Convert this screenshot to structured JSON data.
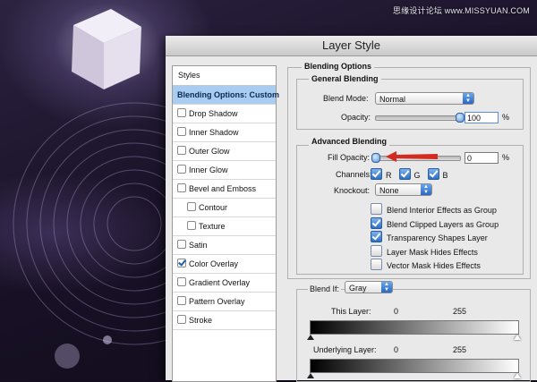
{
  "watermark": "思缘设计论坛 www.MISSYUAN.COM",
  "dialog": {
    "title": "Layer Style",
    "styles_header": "Styles",
    "styles": [
      {
        "label": "Blending Options: Custom",
        "selected": true,
        "checkbox": false,
        "checked": false,
        "indent": false
      },
      {
        "label": "Drop Shadow",
        "selected": false,
        "checkbox": true,
        "checked": false,
        "indent": false
      },
      {
        "label": "Inner Shadow",
        "selected": false,
        "checkbox": true,
        "checked": false,
        "indent": false
      },
      {
        "label": "Outer Glow",
        "selected": false,
        "checkbox": true,
        "checked": false,
        "indent": false
      },
      {
        "label": "Inner Glow",
        "selected": false,
        "checkbox": true,
        "checked": false,
        "indent": false
      },
      {
        "label": "Bevel and Emboss",
        "selected": false,
        "checkbox": true,
        "checked": false,
        "indent": false
      },
      {
        "label": "Contour",
        "selected": false,
        "checkbox": true,
        "checked": false,
        "indent": true
      },
      {
        "label": "Texture",
        "selected": false,
        "checkbox": true,
        "checked": false,
        "indent": true
      },
      {
        "label": "Satin",
        "selected": false,
        "checkbox": true,
        "checked": false,
        "indent": false
      },
      {
        "label": "Color Overlay",
        "selected": false,
        "checkbox": true,
        "checked": true,
        "indent": false
      },
      {
        "label": "Gradient Overlay",
        "selected": false,
        "checkbox": true,
        "checked": false,
        "indent": false
      },
      {
        "label": "Pattern Overlay",
        "selected": false,
        "checkbox": true,
        "checked": false,
        "indent": false
      },
      {
        "label": "Stroke",
        "selected": false,
        "checkbox": true,
        "checked": false,
        "indent": false
      }
    ],
    "blending_options": {
      "title": "Blending Options",
      "general": {
        "title": "General Blending",
        "blend_mode_label": "Blend Mode:",
        "blend_mode_value": "Normal",
        "opacity_label": "Opacity:",
        "opacity_value": "100",
        "opacity_fraction": 1.0,
        "percent": "%"
      },
      "advanced": {
        "title": "Advanced Blending",
        "fill_opacity_label": "Fill Opacity:",
        "fill_opacity_value": "0",
        "fill_opacity_fraction": 0.0,
        "percent": "%",
        "channels_label": "Channels:",
        "channels": [
          {
            "label": "R",
            "checked": true
          },
          {
            "label": "G",
            "checked": true
          },
          {
            "label": "B",
            "checked": true
          }
        ],
        "knockout_label": "Knockout:",
        "knockout_value": "None",
        "options": [
          {
            "label": "Blend Interior Effects as Group",
            "checked": false
          },
          {
            "label": "Blend Clipped Layers as Group",
            "checked": true
          },
          {
            "label": "Transparency Shapes Layer",
            "checked": true
          },
          {
            "label": "Layer Mask Hides Effects",
            "checked": false
          },
          {
            "label": "Vector Mask Hides Effects",
            "checked": false
          }
        ]
      },
      "blend_if": {
        "label": "Blend If:",
        "value": "Gray",
        "this_layer_label": "This Layer:",
        "this_layer_min": "0",
        "this_layer_max": "255",
        "underlying_label": "Underlying Layer:",
        "underlying_min": "0",
        "underlying_max": "255"
      }
    }
  },
  "colors": {
    "selection": "#a9cdf0",
    "accent_blue": "#2b67c4",
    "arrow_red": "#d42a20"
  }
}
